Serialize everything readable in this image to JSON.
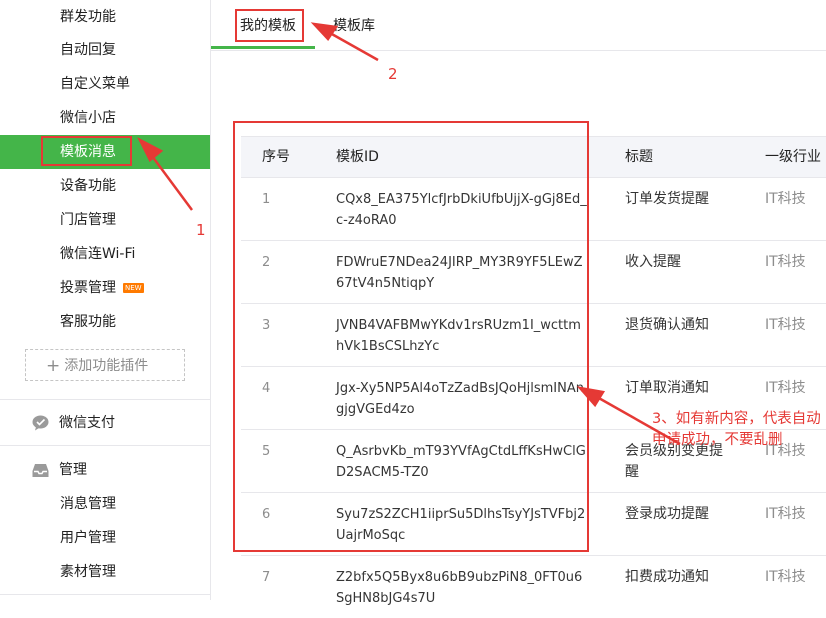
{
  "sidebar": {
    "items": [
      {
        "label": "群发功能"
      },
      {
        "label": "自动回复"
      },
      {
        "label": "自定义菜单"
      },
      {
        "label": "微信小店"
      },
      {
        "label": "模板消息"
      },
      {
        "label": "设备功能"
      },
      {
        "label": "门店管理"
      },
      {
        "label": "微信连Wi-Fi"
      },
      {
        "label": "投票管理",
        "badge": "NEW"
      },
      {
        "label": "客服功能"
      }
    ],
    "add_plugin": "添加功能插件",
    "pay_section": "微信支付",
    "manage_section": "管理",
    "manage_items": [
      {
        "label": "消息管理"
      },
      {
        "label": "用户管理"
      },
      {
        "label": "素材管理"
      }
    ]
  },
  "tabs": {
    "mine": "我的模板",
    "library": "模板库"
  },
  "table": {
    "headers": {
      "no": "序号",
      "id": "模板ID",
      "title": "标题",
      "industry": "一级行业"
    },
    "rows": [
      {
        "no": "1",
        "id": "CQx8_EA375YlcfJrbDkiUfbUjjX-gGj8Ed_c-z4oRA0",
        "title": "订单发货提醒",
        "industry": "IT科技"
      },
      {
        "no": "2",
        "id": "FDWruE7NDea24JIRP_MY3R9YF5LEwZ67tV4n5NtiqpY",
        "title": "收入提醒",
        "industry": "IT科技"
      },
      {
        "no": "3",
        "id": "JVNB4VAFBMwYKdv1rsRUzm1I_wcttmhVk1BsCSLhzYc",
        "title": "退货确认通知",
        "industry": "IT科技"
      },
      {
        "no": "4",
        "id": "Jgx-Xy5NP5Al4oTzZadBsJQoHjlsmINAngjgVGEd4zo",
        "title": "订单取消通知",
        "industry": "IT科技"
      },
      {
        "no": "5",
        "id": "Q_AsrbvKb_mT93YVfAgCtdLffKsHwClGD2SACM5-TZ0",
        "title": "会员级别变更提醒",
        "industry": "IT科技"
      },
      {
        "no": "6",
        "id": "Syu7zS2ZCH1iiprSu5DlhsTsyYJsTVFbj2UajrMoSqc",
        "title": "登录成功提醒",
        "industry": "IT科技"
      },
      {
        "no": "7",
        "id": "Z2bfx5Q5Byx8u6bB9ubzPiN8_0FT0u6SgHN8bJG4s7U",
        "title": "扣费成功通知",
        "industry": "IT科技"
      }
    ]
  },
  "annotations": {
    "n1": "1",
    "n2": "2",
    "n3": "3、如有新内容，代表自动申请成功，不要乱删"
  },
  "colors": {
    "accent": "#44b549",
    "annotation": "#e53935"
  }
}
